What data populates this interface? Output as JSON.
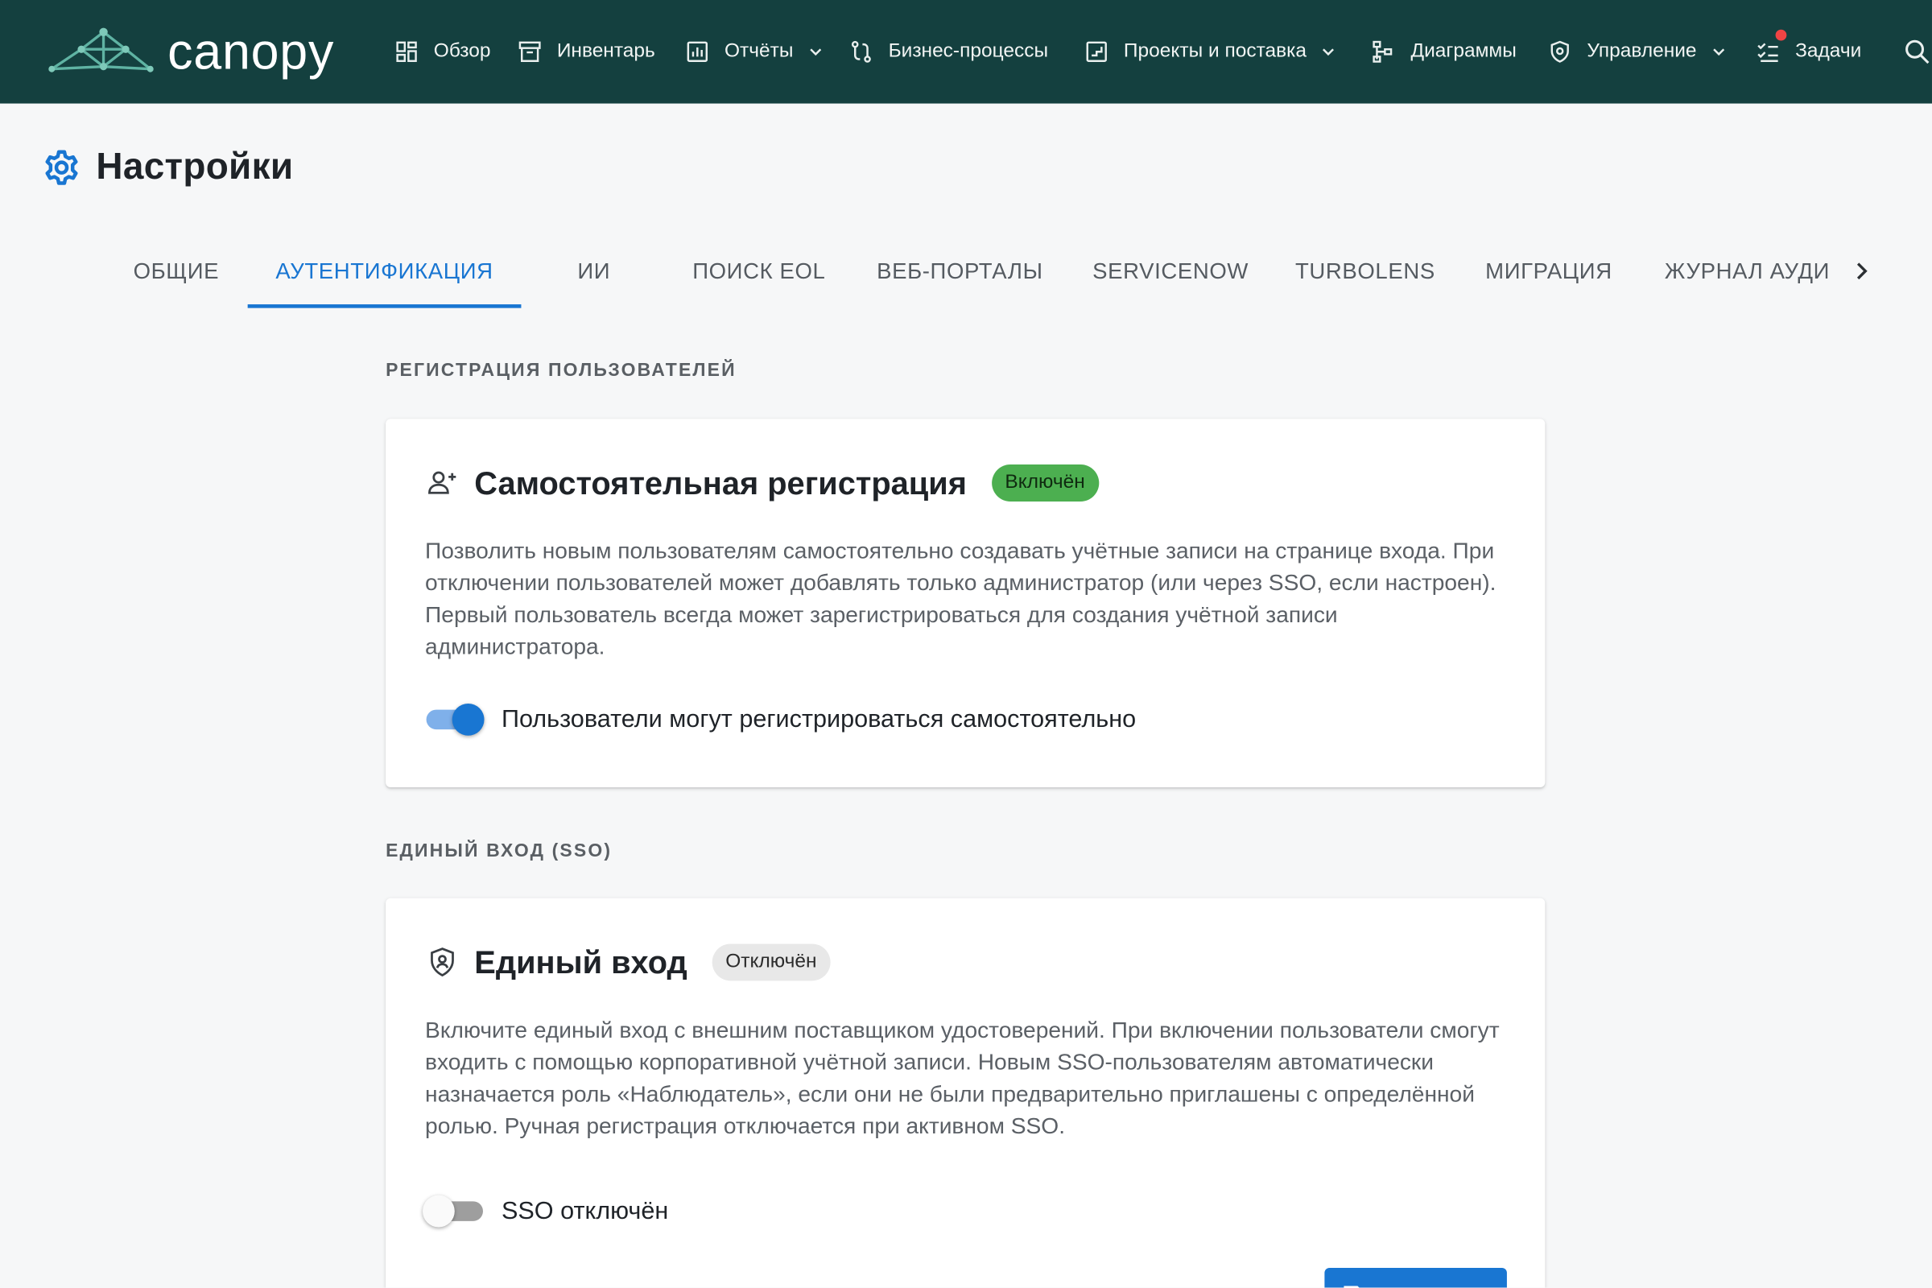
{
  "app": {
    "name": "canopy"
  },
  "nav": {
    "items": [
      {
        "label": "Обзор",
        "icon": "dashboard-icon"
      },
      {
        "label": "Инвентарь",
        "icon": "archive-icon"
      },
      {
        "label": "Отчёты",
        "icon": "report-chart-icon",
        "has_dropdown": true
      },
      {
        "label": "Бизнес-процессы",
        "icon": "workflow-icon"
      },
      {
        "label": "Проекты и поставка",
        "icon": "project-board-icon",
        "has_dropdown": true
      },
      {
        "label": "Диаграммы",
        "icon": "hierarchy-icon"
      },
      {
        "label": "Управление",
        "icon": "shield-icon",
        "has_dropdown": true
      },
      {
        "label": "Задачи",
        "icon": "checklist-icon",
        "has_notification": true
      }
    ],
    "search_icon": "search-icon"
  },
  "page": {
    "title": "Настройки",
    "icon": "gear-icon"
  },
  "tabs": {
    "items": [
      {
        "label": "ОБЩИЕ"
      },
      {
        "label": "АУТЕНТИФИКАЦИЯ",
        "active": true
      },
      {
        "label": "ИИ"
      },
      {
        "label": "ПОИСК EOL"
      },
      {
        "label": "ВЕБ-ПОРТАЛЫ"
      },
      {
        "label": "SERVICENOW"
      },
      {
        "label": "TURBOLENS"
      },
      {
        "label": "МИГРАЦИЯ"
      },
      {
        "label": "ЖУРНАЛ АУДИТА"
      }
    ],
    "scroll_icon": "chevron-right-icon"
  },
  "registration": {
    "section_label": "РЕГИСТРАЦИЯ ПОЛЬЗОВАТЕЛЕЙ",
    "title": "Самостоятельная регистрация",
    "icon": "person-add-icon",
    "badge": "Включён",
    "description": "Позволить новым пользователям самостоятельно создавать учётные записи на странице входа. При отключении пользователей может добавлять только администратор (или через SSO, если настроен). Первый пользователь всегда может зарегистрироваться для создания учётной записи администратора.",
    "toggle_label": "Пользователи могут регистрироваться самостоятельно",
    "toggle_on": true
  },
  "sso": {
    "section_label": "ЕДИНЫЙ ВХОД (SSO)",
    "title": "Единый вход",
    "icon": "shield-user-icon",
    "badge": "Отключён",
    "description": "Включите единый вход с внешним поставщиком удостоверений. При включении пользователи смогут входить с помощью корпоративной учётной записи. Новым SSO-пользователям автоматически назначается роль «Наблюдатель», если они не были предварительно приглашены с определённой ролью. Ручная регистрация отключается при активном SSO.",
    "toggle_label": "SSO отключён",
    "toggle_on": false,
    "save_icon": "save-icon"
  },
  "colors": {
    "topbar": "#14403f",
    "accent": "#1976d2",
    "badge_on": "#4caf50",
    "badge_off": "#e8e8e8",
    "notification": "#ef4444"
  }
}
